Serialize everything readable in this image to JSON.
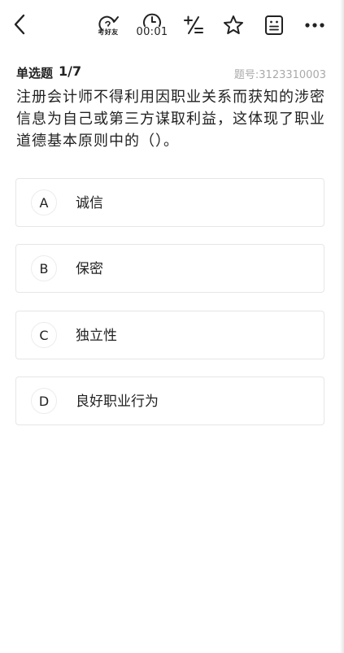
{
  "toolbar": {
    "ask_friend_label": "考好友",
    "timer": "00:01",
    "icons": {
      "back": "chevron-left-icon",
      "ask_friend": "share-question-icon",
      "timer": "clock-icon",
      "calculator": "calculator-icon",
      "favorite": "star-icon",
      "answer_sheet": "answer-sheet-icon",
      "more": "more-icon"
    }
  },
  "question": {
    "type": "单选题",
    "progress": "1/7",
    "id_label": "题号:3123310003",
    "stem": "注册会计师不得利用因职业关系而获知的涉密信息为自己或第三方谋取利益，这体现了职业道德基本原则中的（）。"
  },
  "options": [
    {
      "letter": "A",
      "text": "诚信"
    },
    {
      "letter": "B",
      "text": "保密"
    },
    {
      "letter": "C",
      "text": "独立性"
    },
    {
      "letter": "D",
      "text": "良好职业行为"
    }
  ],
  "colors": {
    "text": "#222222",
    "muted": "#a9a9a9",
    "border": "#e6e6e6"
  }
}
